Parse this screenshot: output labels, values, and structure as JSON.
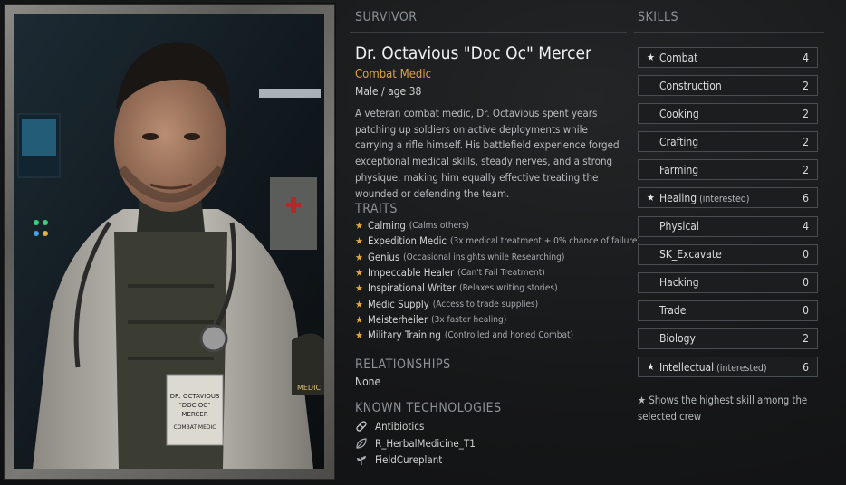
{
  "survivor": {
    "section_title": "SURVIVOR",
    "name": "Dr. Octavious \"Doc Oc\" Mercer",
    "role": "Combat Medic",
    "gender_age": "Male / age 38",
    "bio": "A veteran combat medic, Dr. Octavious spent years patching up soldiers on active deployments while carrying a rifle himself. His battlefield experience forged exceptional medical skills, steady nerves, and a strong physique, making him equally effective treating the wounded or defending the team.",
    "badge_text": "DR. OCTAVIOUS\n\"DOC OC\"\nMERCER\nCOMBAT MEDIC",
    "patch_text": "MEDIC"
  },
  "traits": {
    "section_title": "TRAITS",
    "items": [
      {
        "name": "Calming",
        "desc": "(Calms others)"
      },
      {
        "name": "Expedition Medic",
        "desc": "(3x medical treatment + 0% chance of failure)"
      },
      {
        "name": "Genius",
        "desc": "(Occasional insights while Researching)"
      },
      {
        "name": "Impeccable Healer",
        "desc": "(Can't Fail Treatment)"
      },
      {
        "name": "Inspirational Writer",
        "desc": "(Relaxes writing stories)"
      },
      {
        "name": "Medic Supply",
        "desc": "(Access to trade supplies)"
      },
      {
        "name": "Meisterheiler",
        "desc": "(3x faster healing)"
      },
      {
        "name": "Military Training",
        "desc": "(Controlled and honed Combat)"
      }
    ],
    "star_glyph": "★",
    "star_color": "#e0a83a"
  },
  "relationships": {
    "section_title": "RELATIONSHIPS",
    "value": "None"
  },
  "technologies": {
    "section_title": "KNOWN TECHNOLOGIES",
    "items": [
      {
        "name": "Antibiotics",
        "icon": "pill-icon"
      },
      {
        "name": "R_HerbalMedicine_T1",
        "icon": "leaf-icon"
      },
      {
        "name": "FieldCureplant",
        "icon": "plant-icon"
      }
    ]
  },
  "skills": {
    "section_title": "SKILLS",
    "items": [
      {
        "name": "Combat",
        "value": "4",
        "star": "★",
        "note": ""
      },
      {
        "name": "Construction",
        "value": "2",
        "star": "",
        "note": ""
      },
      {
        "name": "Cooking",
        "value": "2",
        "star": "",
        "note": ""
      },
      {
        "name": "Crafting",
        "value": "2",
        "star": "",
        "note": ""
      },
      {
        "name": "Farming",
        "value": "2",
        "star": "",
        "note": ""
      },
      {
        "name": "Healing",
        "value": "6",
        "star": "★",
        "note": "(interested)"
      },
      {
        "name": "Physical",
        "value": "4",
        "star": "",
        "note": ""
      },
      {
        "name": "SK_Excavate",
        "value": "0",
        "star": "",
        "note": ""
      },
      {
        "name": "Hacking",
        "value": "0",
        "star": "",
        "note": ""
      },
      {
        "name": "Trade",
        "value": "0",
        "star": "",
        "note": ""
      },
      {
        "name": "Biology",
        "value": "2",
        "star": "",
        "note": ""
      },
      {
        "name": "Intellectual",
        "value": "6",
        "star": "★",
        "note": "(interested)"
      }
    ],
    "legend": "★ Shows the highest skill among the selected crew"
  },
  "colors": {
    "accent": "#d9a24b",
    "background": "#161718",
    "skill_border": "#4a4d50"
  }
}
